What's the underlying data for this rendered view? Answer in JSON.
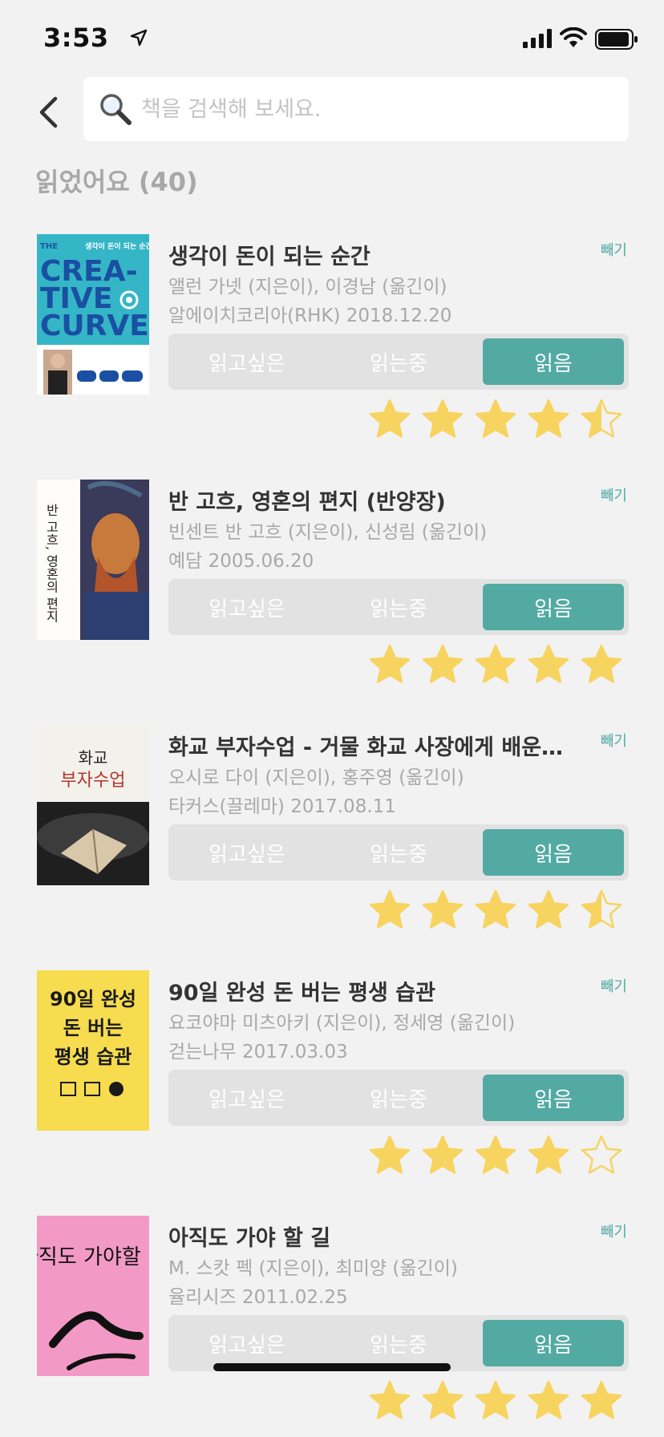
{
  "status_bar": {
    "time": "3:53"
  },
  "search": {
    "placeholder": "책을 검색해 보세요."
  },
  "section": {
    "title": "읽었어요 (40)"
  },
  "labels": {
    "want": "읽고싶은",
    "reading": "읽는중",
    "read": "읽음",
    "remove": "빼기"
  },
  "colors": {
    "accent": "#52aaa3",
    "star": "#f7d460",
    "background": "#f2f2f2"
  },
  "books": [
    {
      "title": "생각이 돈이 되는 순간",
      "authors": "앨런 가넷 (지은이), 이경남 (옮긴이)",
      "publisher_date": "알에이치코리아(RHK) 2018.12.20",
      "status": "읽음",
      "rating": 4.5,
      "cover": {
        "title_top": "생각이 돈이 되는 순간",
        "words": [
          "CREA-",
          "TIVE",
          "CURVE"
        ],
        "prefix": "THE",
        "bg": "#35b6c6"
      }
    },
    {
      "title": "반 고흐, 영혼의 편지 (반양장)",
      "authors": "빈센트 반 고흐 (지은이), 신성림 (옮긴이)",
      "publisher_date": "예담 2005.06.20",
      "status": "읽음",
      "rating": 5,
      "cover": {
        "vertical_title": "반 고흐, 영혼의 편지"
      }
    },
    {
      "title": "화교 부자수업 - 거물 화교 사장에게 배운 부자의 비밀",
      "authors": "오시로 다이 (지은이), 홍주영 (옮긴이)",
      "publisher_date": "타커스(끌레마) 2017.08.11",
      "status": "읽음",
      "rating": 4.5,
      "cover": {
        "line1": "화교",
        "line2": "부자수업"
      }
    },
    {
      "title": "90일 완성 돈 버는 평생 습관",
      "authors": "요코야마 미츠아키 (지은이), 정세영 (옮긴이)",
      "publisher_date": "걷는나무 2017.03.03",
      "status": "읽음",
      "rating": 4,
      "cover": {
        "lines": [
          "90일 완성",
          "돈 버는",
          "평생 습관"
        ],
        "bg": "#f6dc4e"
      }
    },
    {
      "title": "아직도 가야 할 길",
      "authors": "M. 스캇 펙 (지은이), 최미양 (옮긴이)",
      "publisher_date": "율리시즈 2011.02.25",
      "status": "읽음",
      "rating": 5,
      "cover": {
        "title": "아직도 가야할 길",
        "bg": "#f29ac5"
      }
    }
  ]
}
